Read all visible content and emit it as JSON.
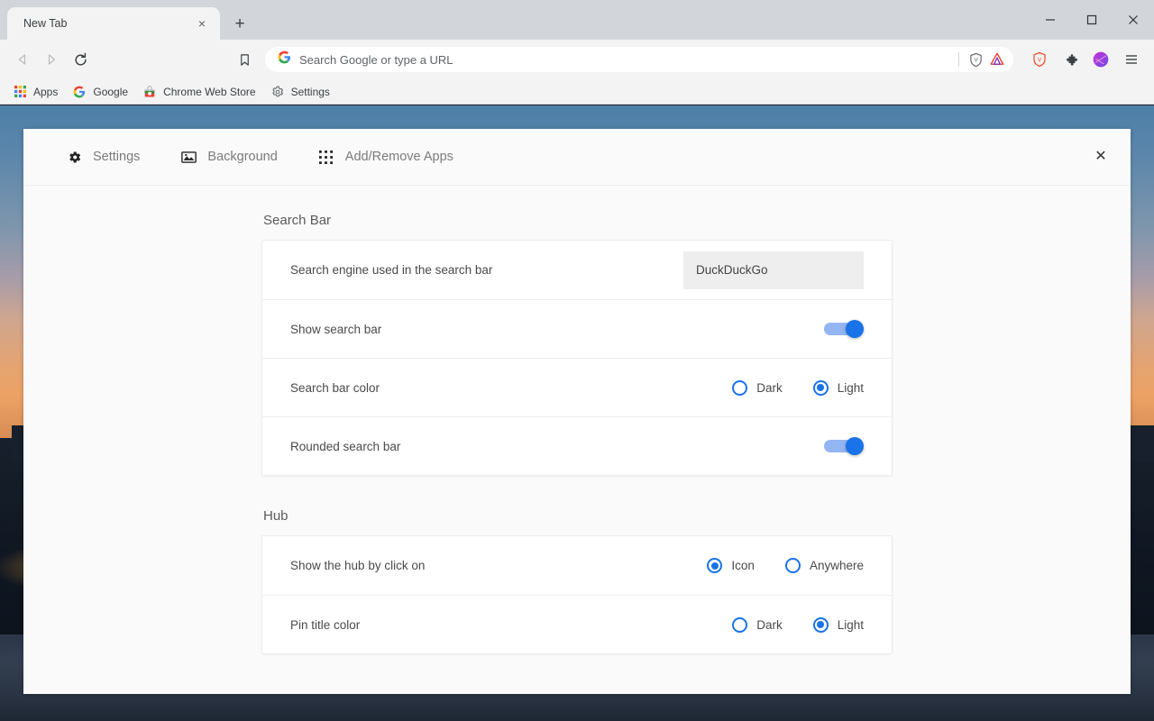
{
  "window": {
    "minimize_label": "Minimize",
    "maximize_label": "Maximize",
    "close_label": "Close"
  },
  "tabstrip": {
    "tab_title": "New Tab",
    "tab_close_label": "×",
    "new_tab_label": "+"
  },
  "toolbar": {
    "back_label": "Back",
    "forward_label": "Forward",
    "reload_label": "Reload",
    "bookmark_label": "Bookmark this tab",
    "omnibox_placeholder": "Search Google or type a URL",
    "omnibox_value": "",
    "brave_shields_label": "Brave Shields",
    "brave_rewards_label": "Brave Rewards",
    "brave_leo_label": "Leo AI",
    "extensions_label": "Extensions",
    "profile_label": "Profile",
    "menu_label": "Customize and control Brave"
  },
  "bookmarks": [
    {
      "label": "Apps",
      "icon": "apps-grid-icon"
    },
    {
      "label": "Google",
      "icon": "google-icon"
    },
    {
      "label": "Chrome Web Store",
      "icon": "chrome-web-store-icon"
    },
    {
      "label": "Settings",
      "icon": "gear-icon"
    }
  ],
  "panel": {
    "nav": [
      {
        "label": "Settings",
        "icon": "gear-icon",
        "active": true
      },
      {
        "label": "Background",
        "icon": "image-icon",
        "active": false
      },
      {
        "label": "Add/Remove Apps",
        "icon": "apps-grid-icon",
        "active": false
      }
    ],
    "close_label": "✕",
    "sections": [
      {
        "title": "Search Bar",
        "rows": [
          {
            "label": "Search engine used in the search bar",
            "control": "select",
            "value": "DuckDuckGo"
          },
          {
            "label": "Show search bar",
            "control": "toggle",
            "value": "on"
          },
          {
            "label": "Search bar color",
            "control": "radio",
            "options": [
              "Dark",
              "Light"
            ],
            "selected": "Light"
          },
          {
            "label": "Rounded search bar",
            "control": "toggle",
            "value": "on"
          }
        ]
      },
      {
        "title": "Hub",
        "rows": [
          {
            "label": "Show the hub by click on",
            "control": "radio",
            "options": [
              "Icon",
              "Anywhere"
            ],
            "selected": "Icon"
          },
          {
            "label": "Pin title color",
            "control": "radio",
            "options": [
              "Dark",
              "Light"
            ],
            "selected": "Light"
          }
        ]
      }
    ]
  },
  "colors": {
    "accent": "#1a73e8",
    "toggle_track": "#93b5f2",
    "panel_bg": "#fafafa",
    "card_bg": "#ffffff"
  }
}
